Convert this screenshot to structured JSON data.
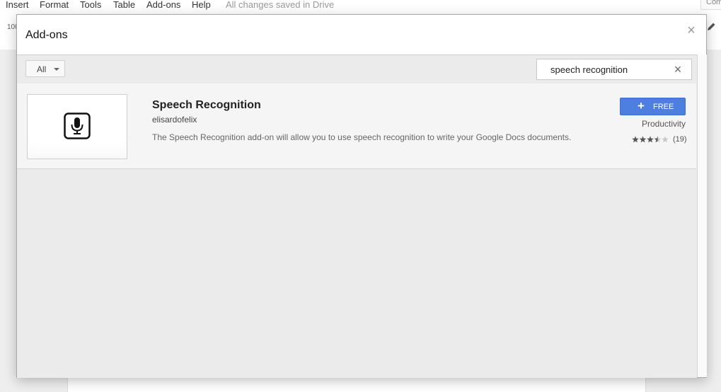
{
  "menu": {
    "items": [
      "Insert",
      "Format",
      "Tools",
      "Table",
      "Add-ons",
      "Help"
    ],
    "save_status": "All changes saved in Drive",
    "corner_button": "Com"
  },
  "toolbar": {
    "zoom": "100"
  },
  "dialog": {
    "title": "Add-ons",
    "close_icon": "close-icon",
    "filter": {
      "selected": "All"
    },
    "search": {
      "value": "speech recognition",
      "clear_icon": "close-icon"
    },
    "results": [
      {
        "icon": "microphone-icon",
        "name": "Speech Recognition",
        "developer": "elisardofelix",
        "description": "The Speech Recognition add-on will allow you to use speech recognition to write your Google Docs documents.",
        "price_label": "FREE",
        "category": "Productivity",
        "rating": 3.5,
        "rating_max": 5,
        "rating_count": "(19)"
      }
    ]
  },
  "colors": {
    "accent": "#4d7fe0",
    "dialog_body": "#ebebeb",
    "star": "#555555",
    "star_empty": "#c8c8c8"
  }
}
